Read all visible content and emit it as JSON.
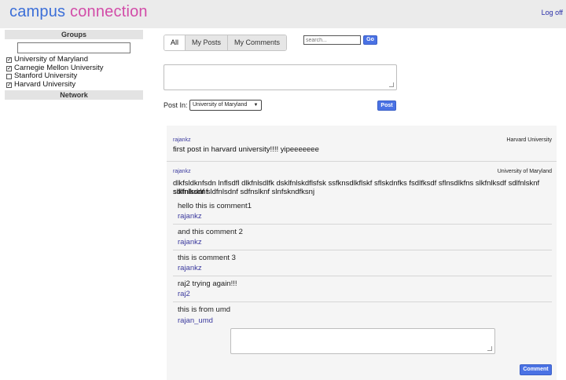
{
  "header": {
    "logo_word1": "campus",
    "logo_word2": "connection",
    "logoff_label": "Log off"
  },
  "sidebar": {
    "groups_heading": "Groups",
    "search_value": "",
    "groups": [
      {
        "label": "University of Maryland",
        "checked": true
      },
      {
        "label": "Carnegie Mellon University",
        "checked": true
      },
      {
        "label": "Stanford University",
        "checked": false
      },
      {
        "label": "Harvard University",
        "checked": true
      }
    ],
    "network_heading": "Network"
  },
  "tabs": [
    "All",
    "My Posts",
    "My Comments"
  ],
  "search": {
    "placeholder": "search...",
    "go_label": "Go"
  },
  "composer": {
    "post_in_label": "Post In:",
    "selected_group": "University of Maryland",
    "post_label": "Post"
  },
  "posts": [
    {
      "user": "rajankz",
      "group": "Harvard University",
      "text": "first post in harvard university!!!! yipeeeeeee"
    },
    {
      "user": "rajankz",
      "group": "University of Maryland",
      "text_line1": "dlkfsldknfsdn lnflsdfl dlkfnlsdlfk dsklfnlskdflsfsk ssfknsdlkflskf sflskdnfks fsdlfksdf sflnsdlkfns slkfnlksdf sdlfnlsknf slkfnlksdnf",
      "text_line2": "sdlfnlsdnf sldfnlsdnf sdfnslknf slnfskndfksnj",
      "comments": [
        {
          "text": "hello this is comment1",
          "user": "rajankz"
        },
        {
          "text": "and this comment 2",
          "user": "rajankz"
        },
        {
          "text": "this is comment 3",
          "user": "rajankz"
        },
        {
          "text": "raj2 trying again!!!",
          "user": "raj2"
        },
        {
          "text": "this is from umd",
          "user": "rajan_umd"
        }
      ],
      "comment_button_label": "Comment"
    }
  ],
  "colors": {
    "logo_blue": "#3c6fd8",
    "logo_pink": "#d24ca8",
    "button_blue": "#4a72e4",
    "username_purple": "#3b3a9e"
  }
}
